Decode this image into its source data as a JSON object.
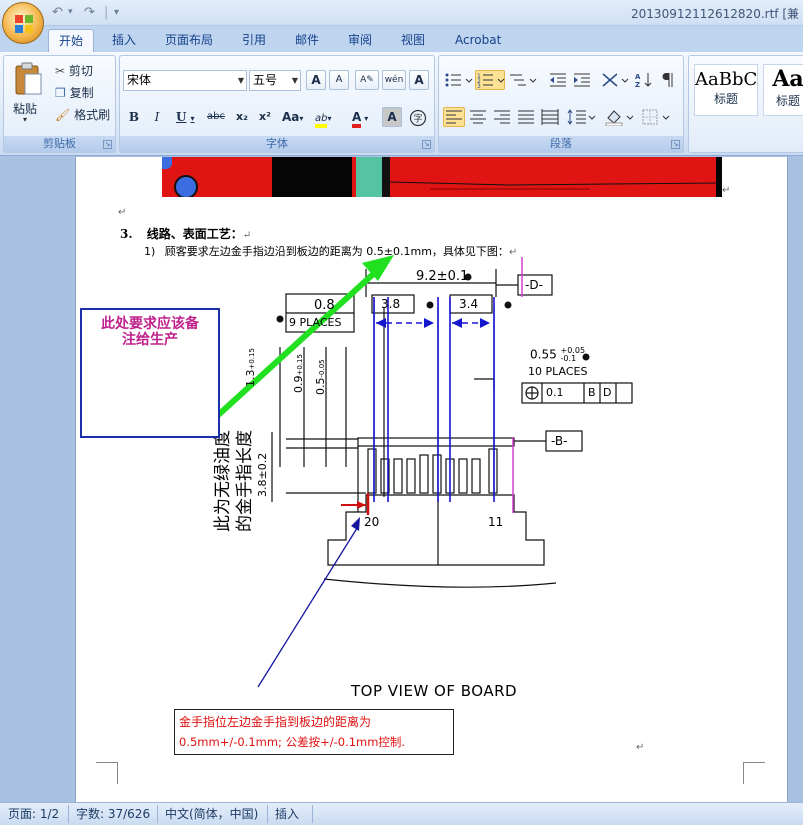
{
  "window": {
    "title": "20130912112612820.rtf [兼"
  },
  "tabs": [
    {
      "label": "开始",
      "active": true
    },
    {
      "label": "插入"
    },
    {
      "label": "页面布局"
    },
    {
      "label": "引用"
    },
    {
      "label": "邮件"
    },
    {
      "label": "审阅"
    },
    {
      "label": "视图"
    },
    {
      "label": "Acrobat"
    }
  ],
  "clipboard": {
    "paste": "粘贴",
    "cut": "剪切",
    "copy": "复制",
    "format_painter": "格式刷",
    "group": "剪贴板"
  },
  "font": {
    "name": "宋体",
    "size": "五号",
    "group": "字体",
    "grow": "A",
    "shrink": "A",
    "phonetic": "wén",
    "border_char": "A",
    "bold": "B",
    "italic": "I",
    "underline": "U",
    "strike": "abc",
    "subscript": "x₂",
    "superscript": "x²",
    "case": "Aa",
    "highlight": "ab",
    "color": "A",
    "shade": "A",
    "enclose": "字",
    "highlight_color": "#ffff00",
    "font_color": "#e02020"
  },
  "paragraph": {
    "group": "段落"
  },
  "styles": {
    "items": [
      {
        "sample": "AaBbC",
        "name": "标题"
      },
      {
        "sample": "Aa",
        "name": "标题"
      }
    ]
  },
  "document": {
    "heading_num": "3.",
    "heading": "线路、表面工艺：",
    "para_num": "1)",
    "para": "顾客要求左边金手指边沿到板边的距离为 0.5±0.1mm，具体见下图：",
    "note_box": [
      "此处要求应该备",
      "注给生产"
    ],
    "drawing": {
      "dim_top": "9.2±0.1",
      "datum_d": "-D-",
      "datum_b": "-B-",
      "box_08": "0.8",
      "places9": "9 PLACES",
      "dim_38": "3.8",
      "dim_34": "3.4",
      "dim_055": "0.55",
      "tol_055_up": "+0.05",
      "tol_055_dn": "-0.1",
      "places10": "10 PLACES",
      "fcf_val": "0.1",
      "fcf_b": "B",
      "fcf_d": "D",
      "v_13": "1.3",
      "v_09": "0.9",
      "v_05": "0.5",
      "tol_15": "+0.15",
      "tol_005": "-0.05",
      "v_38": "3.8±0.2",
      "pin_20": "20",
      "pin_11": "11",
      "vert_note_1": "此为无绿油度",
      "vert_note_2": "的金手指长度",
      "caption": "TOP VIEW OF BOARD"
    },
    "red_note": [
      "金手指位左边金手指到板边的距离为",
      "0.5mm+/-0.1mm; 公差按+/-0.1mm控制."
    ]
  },
  "status": {
    "page": "页面: 1/2",
    "words": "字数: 37/626",
    "lang": "中文(简体，中国)",
    "mode": "插入"
  }
}
